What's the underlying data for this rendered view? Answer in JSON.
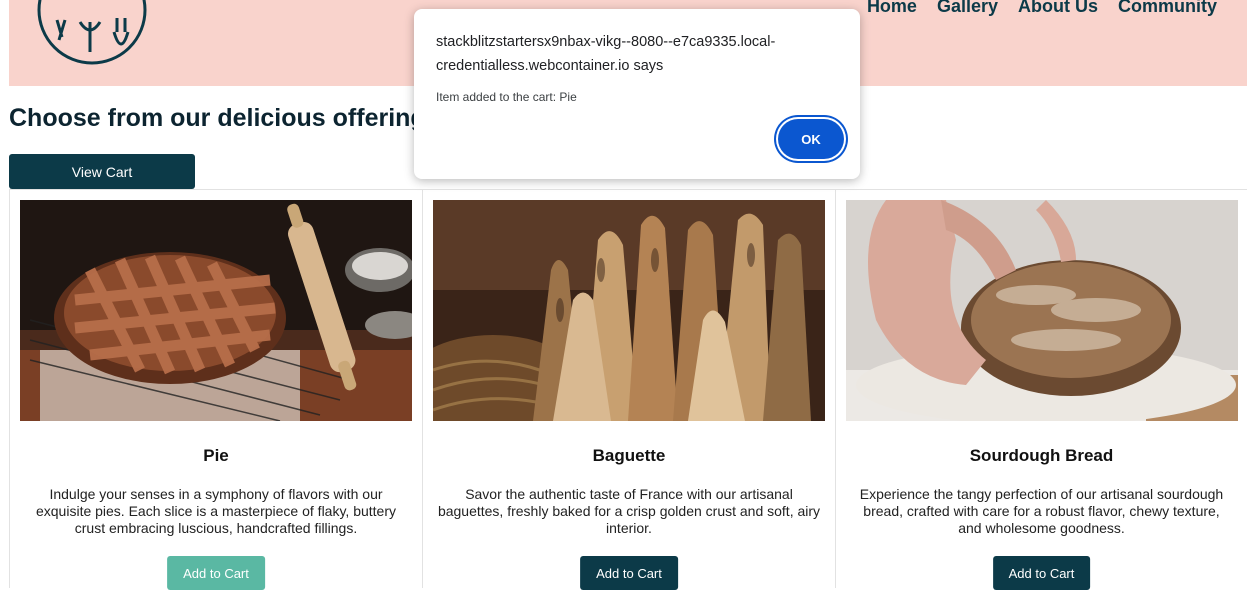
{
  "nav": {
    "items": [
      "Home",
      "Gallery",
      "About Us",
      "Community"
    ]
  },
  "heading": "Choose from our delicious offerings",
  "view_cart_label": "View Cart",
  "products": [
    {
      "name": "Pie",
      "description": "Indulge your senses in a symphony of flavors with our exquisite pies. Each slice is a masterpiece of flaky, buttery crust embracing luscious, handcrafted fillings.",
      "button_label": "Add to Cart",
      "button_color": "#5ab8a3"
    },
    {
      "name": "Baguette",
      "description": "Savor the authentic taste of France with our artisanal baguettes, freshly baked for a crisp golden crust and soft, airy interior.",
      "button_label": "Add to Cart",
      "button_color": "#0c3a48"
    },
    {
      "name": "Sourdough Bread",
      "description": "Experience the tangy perfection of our artisanal sourdough bread, crafted with care for a robust flavor, chewy texture, and wholesome goodness.",
      "button_label": "Add to Cart",
      "button_color": "#0c3a48"
    }
  ],
  "dialog": {
    "origin": "stackblitzstartersx9nbax-vikg--8080--e7ca9335.local-credentialless.webcontainer.io says",
    "message": "Item added to the cart: Pie",
    "ok_label": "OK"
  },
  "colors": {
    "header_bg": "#f9d3cc",
    "brand_dark": "#0c3a48",
    "dialog_accent": "#0b57d0"
  }
}
